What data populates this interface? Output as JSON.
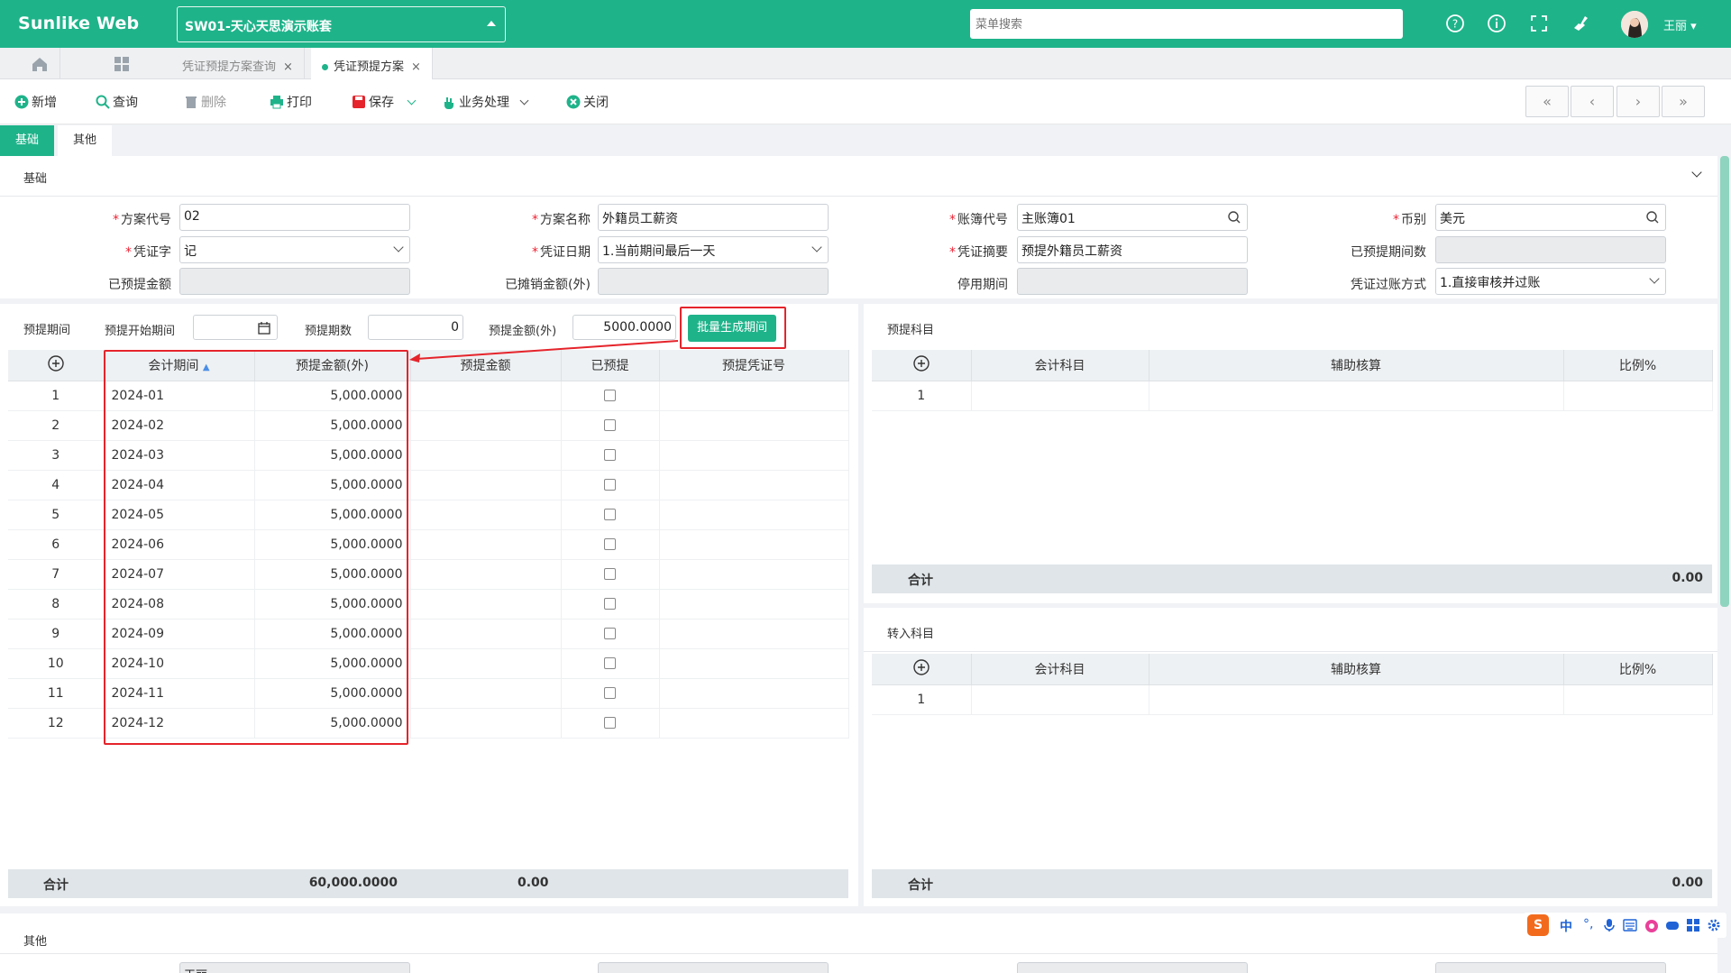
{
  "app": {
    "brand": "Sunlike Web",
    "account": "SW01-天心天思演示账套",
    "search_placeholder": "菜单搜索",
    "user": "王丽 ▾"
  },
  "tabs": [
    {
      "label": "凭证预提方案查询",
      "active": false
    },
    {
      "label": "凭证预提方案",
      "active": true
    }
  ],
  "toolbar": {
    "new": "新增",
    "query": "查询",
    "delete": "删除",
    "print": "打印",
    "save": "保存",
    "business": "业务处理",
    "close": "关闭"
  },
  "pager": {
    "first": "«",
    "prev": "‹",
    "next": "›",
    "last": "»"
  },
  "subtabs": {
    "basic": "基础",
    "other": "其他"
  },
  "basic": {
    "section_title": "基础",
    "labels": {
      "scheme_code": "方案代号",
      "scheme_name": "方案名称",
      "book_code": "账簿代号",
      "currency": "币别",
      "voucher_word": "凭证字",
      "voucher_date": "凭证日期",
      "voucher_summary": "凭证摘要",
      "accrued_periods": "已预提期间数",
      "accrued_amount": "已预提金额",
      "amortized_amount": "已摊销金额(外)",
      "stop_period": "停用期间",
      "posting_method": "凭证过账方式"
    },
    "values": {
      "scheme_code": "02",
      "scheme_name": "外籍员工薪资",
      "book_code": "主账簿01",
      "currency": "美元",
      "voucher_word": "记",
      "voucher_date": "1.当前期间最后一天",
      "voucher_summary": "预提外籍员工薪资",
      "posting_method": "1.直接审核并过账"
    }
  },
  "periods": {
    "section_title": "预提期间",
    "start_label": "预提开始期间",
    "count_label": "预提期数",
    "count_value": "0",
    "amount_label": "预提金额(外)",
    "amount_value": "5000.0000",
    "batch_button": "批量生成期间",
    "columns": [
      "会计期间",
      "预提金额(外)",
      "预提金额",
      "已预提",
      "预提凭证号"
    ],
    "rows": [
      {
        "no": "1",
        "period": "2024-01",
        "amount": "5,000.0000"
      },
      {
        "no": "2",
        "period": "2024-02",
        "amount": "5,000.0000"
      },
      {
        "no": "3",
        "period": "2024-03",
        "amount": "5,000.0000"
      },
      {
        "no": "4",
        "period": "2024-04",
        "amount": "5,000.0000"
      },
      {
        "no": "5",
        "period": "2024-05",
        "amount": "5,000.0000"
      },
      {
        "no": "6",
        "period": "2024-06",
        "amount": "5,000.0000"
      },
      {
        "no": "7",
        "period": "2024-07",
        "amount": "5,000.0000"
      },
      {
        "no": "8",
        "period": "2024-08",
        "amount": "5,000.0000"
      },
      {
        "no": "9",
        "period": "2024-09",
        "amount": "5,000.0000"
      },
      {
        "no": "10",
        "period": "2024-10",
        "amount": "5,000.0000"
      },
      {
        "no": "11",
        "period": "2024-11",
        "amount": "5,000.0000"
      },
      {
        "no": "12",
        "period": "2024-12",
        "amount": "5,000.0000"
      }
    ],
    "total_label": "合计",
    "total_foreign": "60,000.0000",
    "total_local": "0.00"
  },
  "accrual_accounts": {
    "section_title": "预提科目",
    "columns": [
      "会计科目",
      "辅助核算",
      "比例%"
    ],
    "row_no": "1",
    "total_label": "合计",
    "total_value": "0.00"
  },
  "transfer_accounts": {
    "section_title": "转入科目",
    "columns": [
      "会计科目",
      "辅助核算",
      "比例%"
    ],
    "row_no": "1",
    "total_label": "合计",
    "total_value": "0.00"
  },
  "other": {
    "section_title": "其他",
    "first_field_value": "王丽"
  },
  "ime": {
    "logo": "S",
    "lang": "中"
  }
}
